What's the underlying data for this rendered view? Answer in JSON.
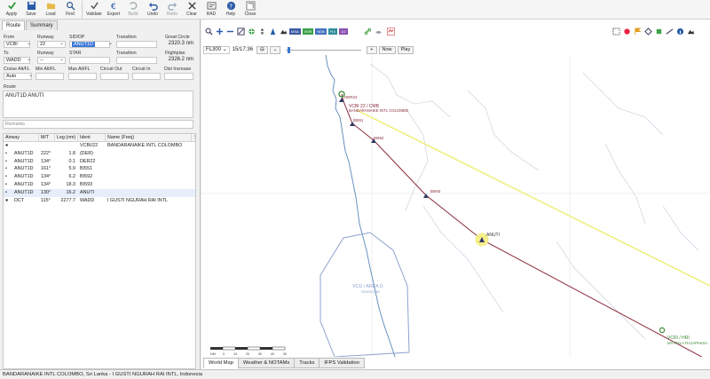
{
  "toolbar": {
    "items": [
      {
        "label": "Apply",
        "icon": "apply-icon"
      },
      {
        "label": "Save",
        "icon": "save-icon"
      },
      {
        "label": "Load",
        "icon": "load-icon"
      },
      {
        "label": "Find",
        "icon": "find-icon"
      },
      {
        "label": "Validate",
        "icon": "validate-icon"
      },
      {
        "label": "Export",
        "icon": "export-icon"
      },
      {
        "label": "Build",
        "icon": "build-icon"
      },
      {
        "label": "Undo",
        "icon": "undo-icon"
      },
      {
        "label": "Redo",
        "icon": "redo-icon"
      },
      {
        "label": "Clear",
        "icon": "clear-icon"
      },
      {
        "label": "RAD",
        "icon": "rad-icon"
      },
      {
        "label": "Help",
        "icon": "help-icon"
      },
      {
        "label": "Close",
        "icon": "close-icon"
      }
    ]
  },
  "tabs": {
    "route": "Route",
    "summary": "Summary"
  },
  "form": {
    "from_label": "From",
    "from_value": "VCBI",
    "runway_label": "Runway",
    "from_runway": "22",
    "sid_label": "SID/DP",
    "sid_value": "ANUT1D",
    "transition_label": "Transition",
    "from_transition": "",
    "great_circle_label": "Great Circle",
    "great_circle_value": "2320.3 nm",
    "to_label": "To",
    "to_value": "WADD",
    "to_runway_label": "Runway",
    "to_runway": "--",
    "star_label": "STAR",
    "star_value": "",
    "to_transition_label": "Transition",
    "to_transition": "",
    "flightplan_label": "Flightplan",
    "flightplan_value": "2326.2 nm",
    "cruise_label": "Cruise Alt/FL",
    "cruise_value": "Auto",
    "minalt_label": "Min Alt/FL",
    "maxalt_label": "Max Alt/FL",
    "circout_label": "Circuit Out",
    "circin_label": "Circuit In",
    "distinc_label": "Dist Increase",
    "route_label": "Route",
    "route_value": "ANUT1D ANUTI",
    "remarks_placeholder": "Remarks"
  },
  "grid": {
    "headers": [
      "Airway",
      "M/T",
      "Leg (nm)",
      "Ident",
      "Name (Freq)"
    ],
    "rows": [
      {
        "marker": "●",
        "airway": "",
        "mt": "",
        "leg": "",
        "ident": "VCBI/22",
        "name": "BANDARANAIKE INTL COLOMBO"
      },
      {
        "marker": "•",
        "airway": "ANUT1D",
        "mt": "222°",
        "leg": "1.8",
        "ident": "(DER)",
        "name": ""
      },
      {
        "marker": "•",
        "airway": "ANUT1D",
        "mt": "134°",
        "leg": "0.1",
        "ident": "DER22",
        "name": ""
      },
      {
        "marker": "•",
        "airway": "ANUT1D",
        "mt": "161°",
        "leg": "5.9",
        "ident": "BI551",
        "name": ""
      },
      {
        "marker": "•",
        "airway": "ANUT1D",
        "mt": "134°",
        "leg": "6.2",
        "ident": "BI592",
        "name": ""
      },
      {
        "marker": "•",
        "airway": "ANUT1D",
        "mt": "134°",
        "leg": "18.3",
        "ident": "BI593",
        "name": ""
      },
      {
        "marker": "•",
        "airway": "ANUT1D",
        "mt": "130°",
        "leg": "16.2",
        "ident": "ANUTI",
        "name": ""
      },
      {
        "marker": "●",
        "airway": "DCT",
        "mt": "115°",
        "leg": "2277.7",
        "ident": "WADD",
        "name": "I GUSTI NGURAH RAI INTL"
      }
    ]
  },
  "map": {
    "flight_level": "FL300",
    "time": "15/17:36",
    "now_button": "Now",
    "play_button": "Play",
    "layer_buttons": [
      "MSA",
      "VOR",
      "NDB",
      "FIX",
      "1/2"
    ],
    "labels": {
      "vcbi_name": "VCBI 22 / CMB",
      "vcbi_full": "BANDARANAIKE INTL COLOMBO",
      "der": "DER22",
      "bi551": "BI551",
      "bi592": "BI592",
      "bi593": "BI593",
      "anuti": "ANUTI",
      "area": "VCD / AREA D",
      "area_alt": "25000/GND",
      "vcri": "VCRI / HRI",
      "vcri_full": "MATTALA RAJAPAKSA",
      "scale_unit": "NM",
      "scale_ticks": [
        "0",
        "10",
        "20",
        "30",
        "40",
        "50"
      ]
    },
    "tabs": [
      "World Map",
      "Weather & NOTAMs",
      "Tracks",
      "IFPS Validation"
    ]
  },
  "status": {
    "text": "BANDARANAIKE INTL COLOMBO, Sri Lanka - I GUSTI NGURAH RAI INTL, Indonesia"
  },
  "colors": {
    "route": "#8b2a3a",
    "coast": "#5a87b8",
    "airspace": "#8fa2cf",
    "yellow_line": "#eeee7a",
    "accent": "#3b78d8"
  }
}
